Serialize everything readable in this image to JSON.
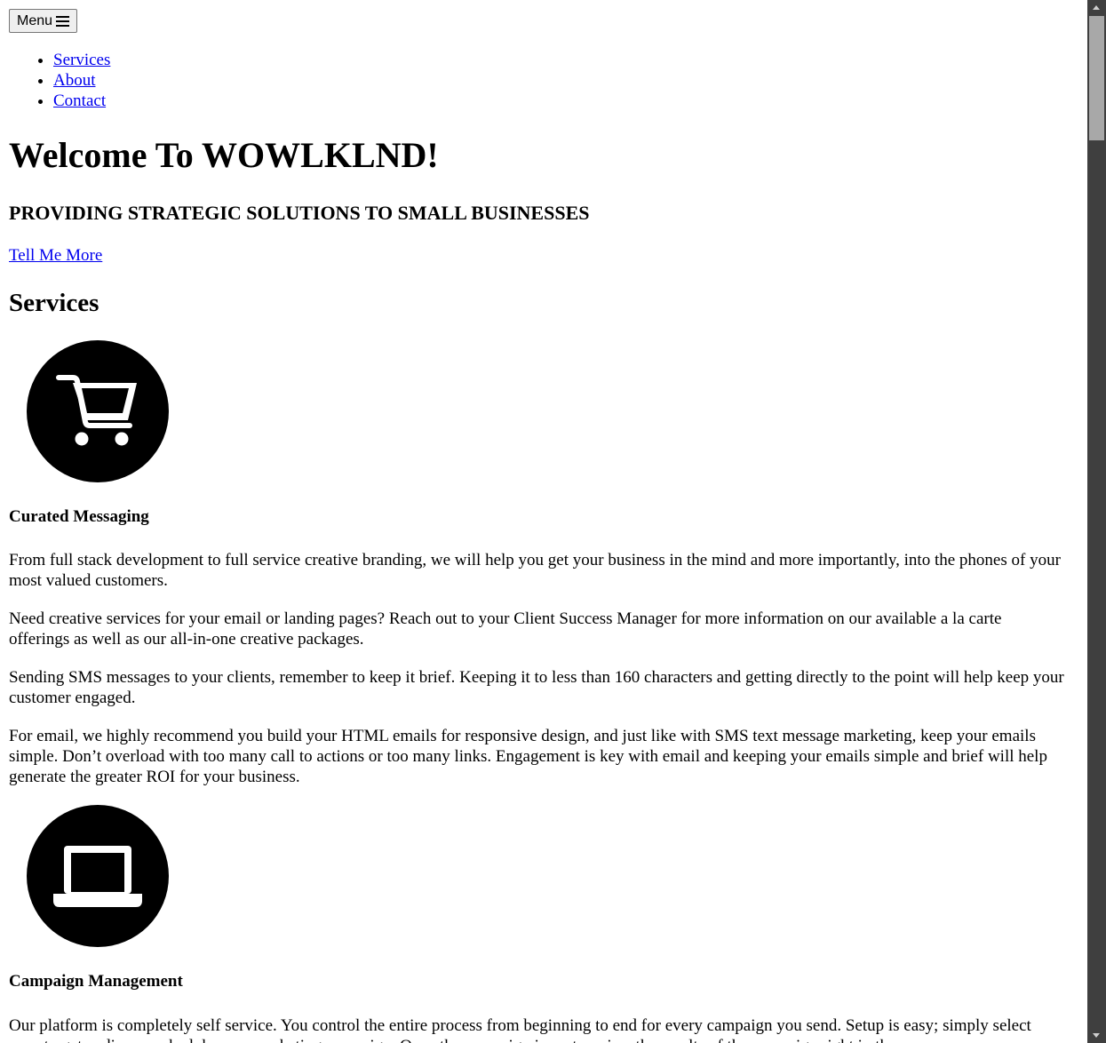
{
  "header": {
    "menu_label": "Menu"
  },
  "nav": {
    "items": [
      {
        "label": "Services"
      },
      {
        "label": "About"
      },
      {
        "label": "Contact"
      }
    ]
  },
  "hero": {
    "title": "Welcome To WOWLKLND!",
    "subtitle": "PROVIDING STRATEGIC SOLUTIONS TO SMALL BUSINESSES",
    "cta_label": "Tell Me More"
  },
  "services": {
    "heading": "Services",
    "items": [
      {
        "icon": "shopping-cart-icon",
        "title": "Curated Messaging",
        "paragraphs": [
          "From full stack development to full service creative branding, we will help you get your business in the mind and more importantly, into the phones of your most valued customers.",
          "Need creative services for your email or landing pages? Reach out to your Client Success Manager for more information on our available a la carte offerings as well as our all-in-one creative packages.",
          "Sending SMS messages to your clients, remember to keep it brief. Keeping it to less than 160 characters and getting directly to the point will help keep your customer engaged.",
          "For email, we highly recommend you build your HTML emails for responsive design, and just like with SMS text message marketing, keep your emails simple. Don’t overload with too many call to actions or too many links. Engagement is key with email and keeping your emails simple and brief will help generate the greater ROI for your business."
        ]
      },
      {
        "icon": "laptop-icon",
        "title": "Campaign Management",
        "paragraphs": [
          "Our platform is completely self service. You control the entire process from beginning to end for every campaign you send. Setup is easy; simply select your target audience, schedule your marketing campaign. Once the campaign is sent, review the results of the campaign right in the"
        ]
      }
    ]
  }
}
